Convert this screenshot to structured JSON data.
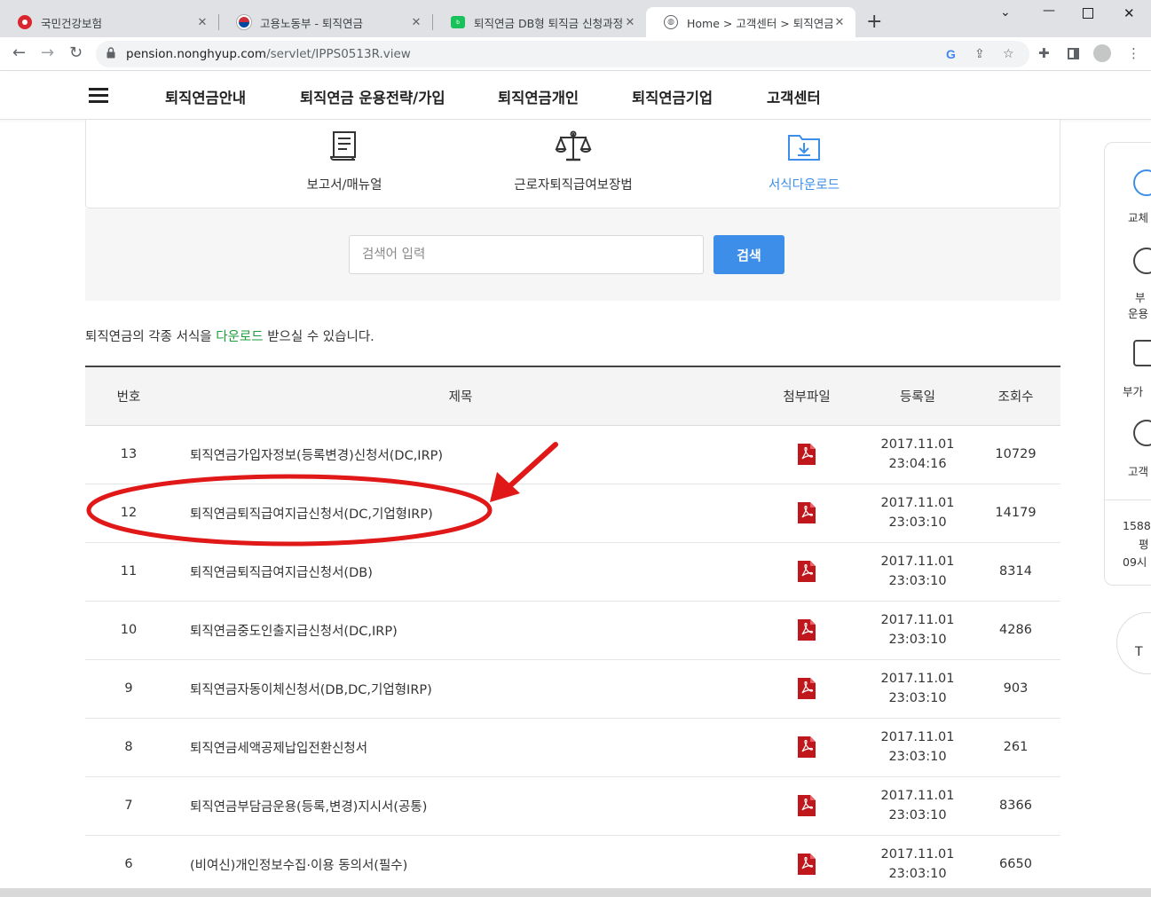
{
  "browser": {
    "tabs": [
      {
        "title": "국민건강보험",
        "favicon": "nhis-icon"
      },
      {
        "title": "고용노동부 - 퇴직연금",
        "favicon": "korea-flag-icon"
      },
      {
        "title": "퇴직연금 DB형 퇴직금 신청과정",
        "favicon": "blog-icon"
      },
      {
        "title": "Home > 고객센터 > 퇴직연금 서",
        "favicon": "globe-icon",
        "active": true
      }
    ],
    "url_host": "pension.nonghyup.com",
    "url_path": "/servlet/IPPS0513R.view"
  },
  "header": {
    "menu": [
      "퇴직연금안내",
      "퇴직연금 운용전략/가입",
      "퇴직연금개인",
      "퇴직연금기업",
      "고객센터"
    ]
  },
  "subnav": [
    {
      "label": "보고서/매뉴얼",
      "icon": "report-icon"
    },
    {
      "label": "근로자퇴직급여보장법",
      "icon": "scales-icon"
    },
    {
      "label": "서식다운로드",
      "icon": "download-folder-icon",
      "active": true
    }
  ],
  "search": {
    "placeholder": "검색어 입력",
    "button": "검색"
  },
  "intro": {
    "before": "퇴직연금의 각종 서식을 ",
    "highlight": "다운로드",
    "after": " 받으실 수 있습니다."
  },
  "table": {
    "headers": [
      "번호",
      "제목",
      "첨부파일",
      "등록일",
      "조회수"
    ],
    "rows": [
      {
        "no": "13",
        "title": "퇴직연금가입자정보(등록변경)신청서(DC,IRP)",
        "date": "2017.11.01",
        "time": "23:04:16",
        "views": "10729"
      },
      {
        "no": "12",
        "title": "퇴직연금퇴직급여지급신청서(DC,기업형IRP)",
        "date": "2017.11.01",
        "time": "23:03:10",
        "views": "14179"
      },
      {
        "no": "11",
        "title": "퇴직연금퇴직급여지급신청서(DB)",
        "date": "2017.11.01",
        "time": "23:03:10",
        "views": "8314"
      },
      {
        "no": "10",
        "title": "퇴직연금중도인출지급신청서(DC,IRP)",
        "date": "2017.11.01",
        "time": "23:03:10",
        "views": "4286"
      },
      {
        "no": "9",
        "title": "퇴직연금자동이체신청서(DB,DC,기업형IRP)",
        "date": "2017.11.01",
        "time": "23:03:10",
        "views": "903"
      },
      {
        "no": "8",
        "title": "퇴직연금세액공제납입전환신청서",
        "date": "2017.11.01",
        "time": "23:03:10",
        "views": "261"
      },
      {
        "no": "7",
        "title": "퇴직연금부담금운용(등록,변경)지시서(공통)",
        "date": "2017.11.01",
        "time": "23:03:10",
        "views": "8366"
      },
      {
        "no": "6",
        "title": "(비여신)개인정보수집·이용 동의서(필수)",
        "date": "2017.11.01",
        "time": "23:03:10",
        "views": "6650"
      }
    ]
  },
  "quick_menu": {
    "items": [
      "교체",
      "부",
      "운용",
      "부가",
      "고객"
    ],
    "phone": "1588",
    "hours_a": "평",
    "hours_b": "09시",
    "top": "T"
  },
  "colors": {
    "accent_blue": "#3d8ee8",
    "highlight_green": "#1e9b3c",
    "annotation_red": "#e01818",
    "pdf_red": "#c0171d"
  }
}
